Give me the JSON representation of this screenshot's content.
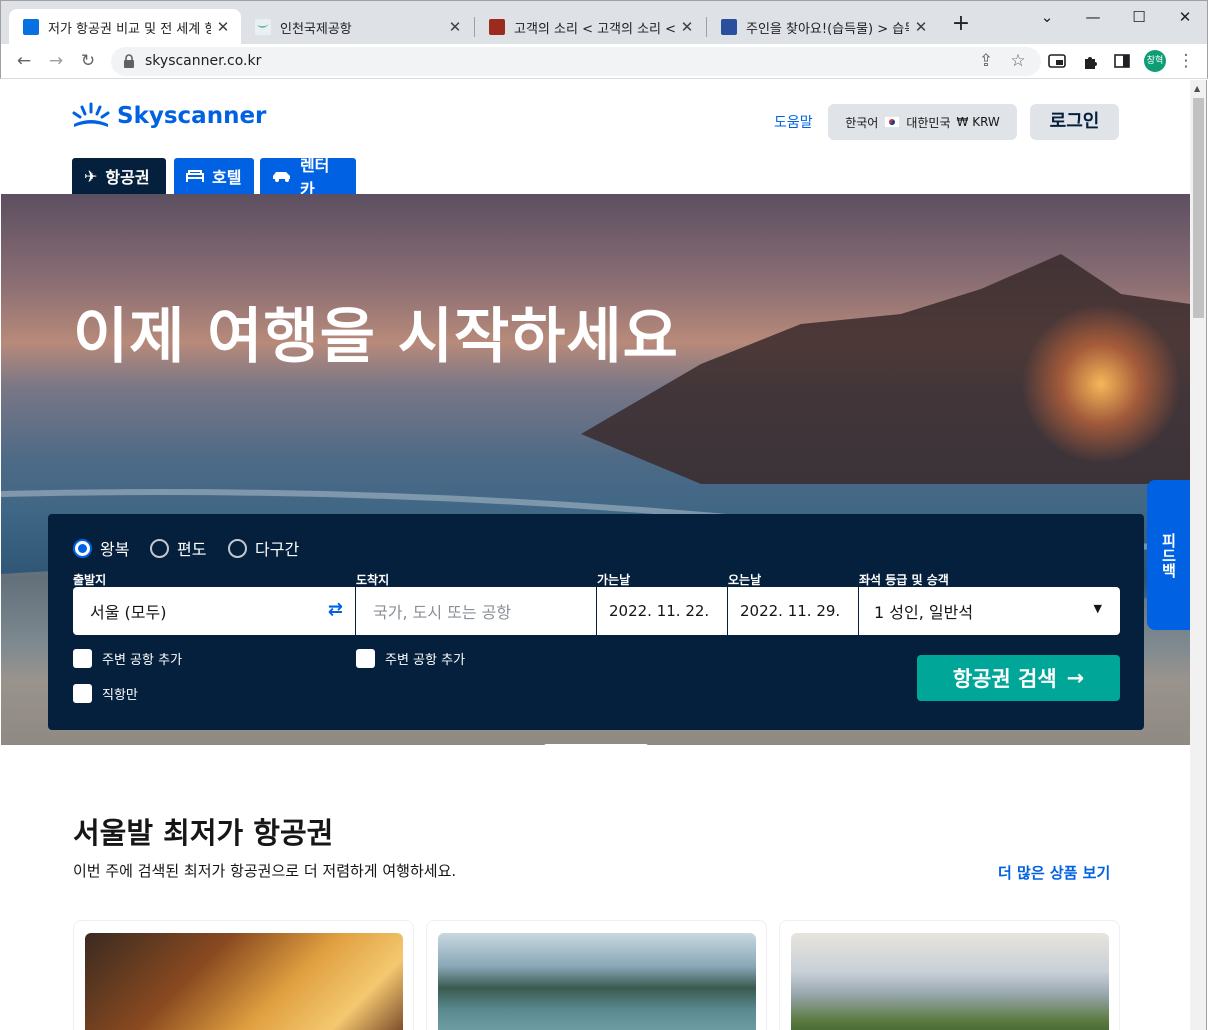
{
  "browser": {
    "tabs": [
      {
        "title": "저가 항공권 비교 및 전 세계 항",
        "active": true
      },
      {
        "title": "인천국제공항",
        "active": false
      },
      {
        "title": "고객의 소리 < 고객의 소리 < ",
        "active": false
      },
      {
        "title": "주인을 찾아요!(습득물) > 습득",
        "active": false
      }
    ],
    "url": "skyscanner.co.kr",
    "profile_initials": "창혁"
  },
  "header": {
    "logo_text": "Skyscanner",
    "help_label": "도움말",
    "locale": {
      "language": "한국어",
      "region": "대한민국",
      "currency": "₩ KRW"
    },
    "login_label": "로그인"
  },
  "nav_tabs": [
    {
      "label": "항공권",
      "icon": "airplane-icon",
      "active": true
    },
    {
      "label": "호텔",
      "icon": "bed-icon",
      "active": false
    },
    {
      "label": "렌터카",
      "icon": "car-icon",
      "active": false
    }
  ],
  "hero": {
    "headline": "이제 여행을 시작하세요"
  },
  "search": {
    "trip_types": [
      {
        "label": "왕복",
        "checked": true
      },
      {
        "label": "편도",
        "checked": false
      },
      {
        "label": "다구간",
        "checked": false
      }
    ],
    "labels": {
      "from": "출발지",
      "to": "도착지",
      "depart": "가는날",
      "return": "오는날",
      "cabin": "좌석 등급 및 승객"
    },
    "from_value": "서울 (모두)",
    "to_placeholder": "국가, 도시 또는 공항",
    "depart_value": "2022. 11. 22.",
    "return_value": "2022. 11. 29.",
    "cabin_value": "1 성인, 일반석",
    "nearby_from": "주변 공항 추가",
    "nearby_to": "주변 공항 추가",
    "direct_only": "직항만",
    "search_button": "항공권 검색"
  },
  "feedback_label": "피드백",
  "section": {
    "title": "서울발 최저가 항공권",
    "subtitle": "이번 주에 검색된 최저가 항공권으로 더 저렴하게 여행하세요.",
    "more_link": "더 많은 상품 보기"
  },
  "colors": {
    "brand_blue": "#0062e3",
    "navy": "#05203c",
    "teal": "#00a698"
  }
}
